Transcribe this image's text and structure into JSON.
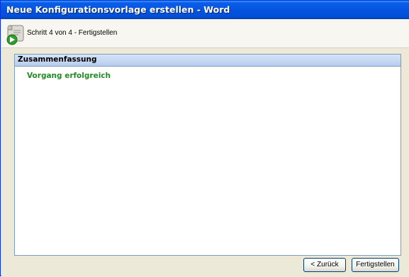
{
  "window": {
    "title": "Neue Konfigurationsvorlage erstellen - Word"
  },
  "header": {
    "step_text": "Schritt 4 von 4 - Fertigstellen",
    "icon": "wizard-scroll-icon"
  },
  "summary": {
    "title": "Zusammenfassung",
    "status": "Vorgang erfolgreich",
    "status_color": "#228b22"
  },
  "buttons": {
    "back_label": "< Zurück",
    "finish_label": "Fertigstellen"
  },
  "colors": {
    "titlebar": "#0554e0",
    "panel_header": "#c8daf4"
  }
}
